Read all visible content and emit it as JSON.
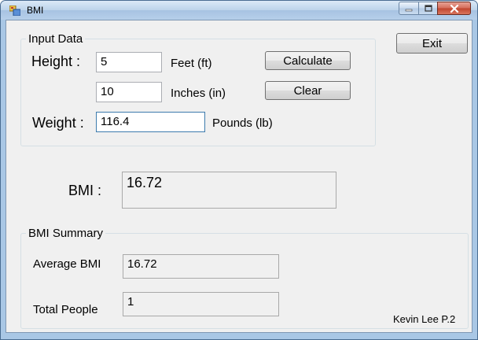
{
  "window": {
    "title": "BMI"
  },
  "input_group": {
    "title": "Input Data",
    "height_label": "Height :",
    "feet_value": "5",
    "feet_unit": "Feet (ft)",
    "inches_value": "10",
    "inches_unit": "Inches (in)",
    "weight_label": "Weight :",
    "weight_value": "116.4",
    "weight_unit": "Pounds (lb)",
    "calculate_label": "Calculate",
    "clear_label": "Clear"
  },
  "exit_label": "Exit",
  "result": {
    "label": "BMI :",
    "value": "16.72"
  },
  "summary": {
    "title": "BMI Summary",
    "average_label": "Average BMI",
    "average_value": "16.72",
    "total_label": "Total People",
    "total_value": "1"
  },
  "author": "Kevin Lee P.2"
}
